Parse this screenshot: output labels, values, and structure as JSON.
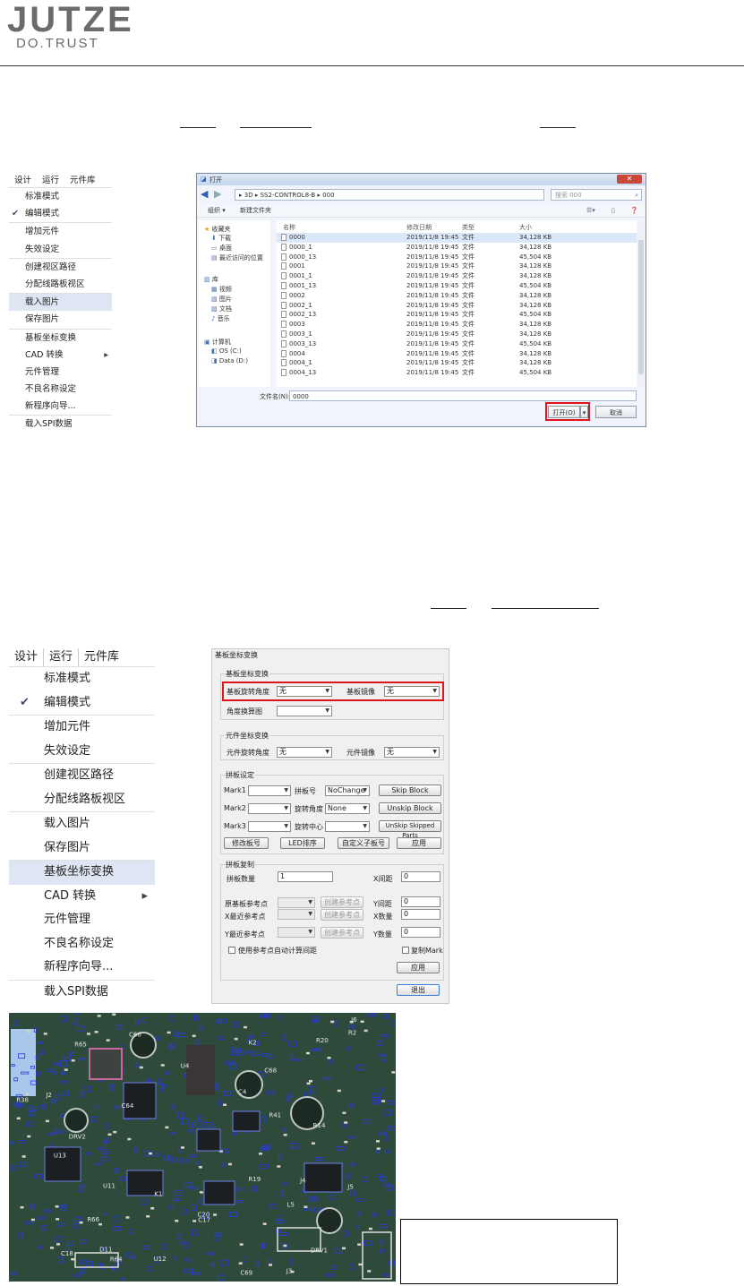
{
  "header": {
    "logo_main": "JUTZE",
    "logo_sub": "DO.TRUST"
  },
  "menu1": {
    "bar": [
      "设计",
      "运行",
      "元件库"
    ],
    "items": [
      "标准模式",
      "编辑模式",
      "增加元件",
      "失效设定",
      "创建视区路径",
      "分配线路板视区",
      "载入图片",
      "保存图片",
      "基板坐标变换",
      "CAD 转换",
      "元件管理",
      "不良名称设定",
      "新程序向导...",
      "载入SPI数据"
    ]
  },
  "file_dialog": {
    "title": "打开",
    "path": [
      "3D",
      "SS2-CONTROL8-B",
      "000"
    ],
    "search_placeholder": "搜索 000",
    "toolbar": {
      "organize": "组织 ▾",
      "new_folder": "新建文件夹"
    },
    "nav": [
      "收藏夹",
      "下载",
      "桌面",
      "最近访问的位置",
      "库",
      "视频",
      "图片",
      "文档",
      "音乐",
      "计算机",
      "OS (C:)",
      "Data (D:)"
    ],
    "columns": [
      "名称",
      "修改日期",
      "类型",
      "大小"
    ],
    "files": [
      {
        "name": "0000",
        "date": "2019/11/8 19:45",
        "type": "文件",
        "size": "34,128 KB"
      },
      {
        "name": "0000_1",
        "date": "2019/11/8 19:45",
        "type": "文件",
        "size": "34,128 KB"
      },
      {
        "name": "0000_13",
        "date": "2019/11/8 19:45",
        "type": "文件",
        "size": "45,504 KB"
      },
      {
        "name": "0001",
        "date": "2019/11/8 19:45",
        "type": "文件",
        "size": "34,128 KB"
      },
      {
        "name": "0001_1",
        "date": "2019/11/8 19:45",
        "type": "文件",
        "size": "34,128 KB"
      },
      {
        "name": "0001_13",
        "date": "2019/11/8 19:45",
        "type": "文件",
        "size": "45,504 KB"
      },
      {
        "name": "0002",
        "date": "2019/11/8 19:45",
        "type": "文件",
        "size": "34,128 KB"
      },
      {
        "name": "0002_1",
        "date": "2019/11/8 19:45",
        "type": "文件",
        "size": "34,128 KB"
      },
      {
        "name": "0002_13",
        "date": "2019/11/8 19:45",
        "type": "文件",
        "size": "45,504 KB"
      },
      {
        "name": "0003",
        "date": "2019/11/8 19:45",
        "type": "文件",
        "size": "34,128 KB"
      },
      {
        "name": "0003_1",
        "date": "2019/11/8 19:45",
        "type": "文件",
        "size": "34,128 KB"
      },
      {
        "name": "0003_13",
        "date": "2019/11/8 19:45",
        "type": "文件",
        "size": "45,504 KB"
      },
      {
        "name": "0004",
        "date": "2019/11/8 19:45",
        "type": "文件",
        "size": "34,128 KB"
      },
      {
        "name": "0004_1",
        "date": "2019/11/8 19:45",
        "type": "文件",
        "size": "34,128 KB"
      },
      {
        "name": "0004_13",
        "date": "2019/11/8 19:45",
        "type": "文件",
        "size": "45,504 KB"
      }
    ],
    "filename_label": "文件名(N):",
    "filename_value": "0000",
    "open_button": "打开(O)",
    "cancel_button": "取消"
  },
  "menu2": {
    "bar": [
      "设计",
      "运行",
      "元件库"
    ],
    "items": [
      "标准模式",
      "编辑模式",
      "增加元件",
      "失效设定",
      "创建视区路径",
      "分配线路板视区",
      "载入图片",
      "保存图片",
      "基板坐标变换",
      "CAD 转换",
      "元件管理",
      "不良名称设定",
      "新程序向导...",
      "载入SPI数据"
    ]
  },
  "transform_panel": {
    "title": "基板坐标变换",
    "board_group": "基板坐标变换",
    "board_rotation_label": "基板旋转角度",
    "board_rotation_value": "无",
    "board_mirror_label": "基板镜像",
    "board_mirror_value": "无",
    "angle_calc_label": "角度换算图",
    "component_group": "元件坐标变换",
    "component_rotation_label": "元件旋转角度",
    "component_rotation_value": "无",
    "component_mirror_label": "元件镜像",
    "component_mirror_value": "无",
    "panel_group": "拼板设定",
    "mark1_label": "Mark1",
    "mark2_label": "Mark2",
    "mark3_label": "Mark3",
    "panel_number_label": "拼板号",
    "panel_number_value": "NoChange",
    "rotation_angle_label": "旋转角度",
    "rotation_angle_value": "None",
    "rotation_center_label": "旋转中心",
    "skip_block": "Skip Block",
    "unskip_block": "Unskip Block",
    "unskip_skipped_parts": "UnSkip Skipped Parts",
    "modify_panel_number": "修改板号",
    "led_sort": "LED排序",
    "custom_panel_number": "自定义子板号",
    "apply_1": "应用",
    "copy_group": "拼板复制",
    "panel_count_label": "拼板数量",
    "panel_count_value": "1",
    "x_spacing_label": "X间距",
    "x_spacing_value": "0",
    "base_ref_label": "原基板参考点",
    "y_spacing_label": "Y间距",
    "y_spacing_value": "0",
    "x_nearest_label": "X最近参考点",
    "x_count_label": "X数量",
    "x_count_value": "0",
    "y_nearest_label": "Y最近参考点",
    "y_count_value": "0",
    "y_count_label": "Y数量",
    "create_ref_button": "创建参考点",
    "auto_calc_label": "使用参考点自动计算间距",
    "copy_mark_label": "复制Mark",
    "apply_2": "应用",
    "exit_button": "退出"
  },
  "pcb": {
    "labels": [
      "U11",
      "U12",
      "U13",
      "J6",
      "J5",
      "J3",
      "C17",
      "C18",
      "C20",
      "C64",
      "C66",
      "C68",
      "C69",
      "R14",
      "R19",
      "R20",
      "R38",
      "R41",
      "R64",
      "R65",
      "R66",
      "D11",
      "K2",
      "U4",
      "J2",
      "J4",
      "DRV1",
      "DRV2",
      "R2",
      "C4",
      "L5",
      "K1"
    ]
  },
  "colors": {
    "accent_red": "#e0151b",
    "menu_highlight": "#dfe6f3",
    "pcb_green": "#2f4a3b"
  }
}
